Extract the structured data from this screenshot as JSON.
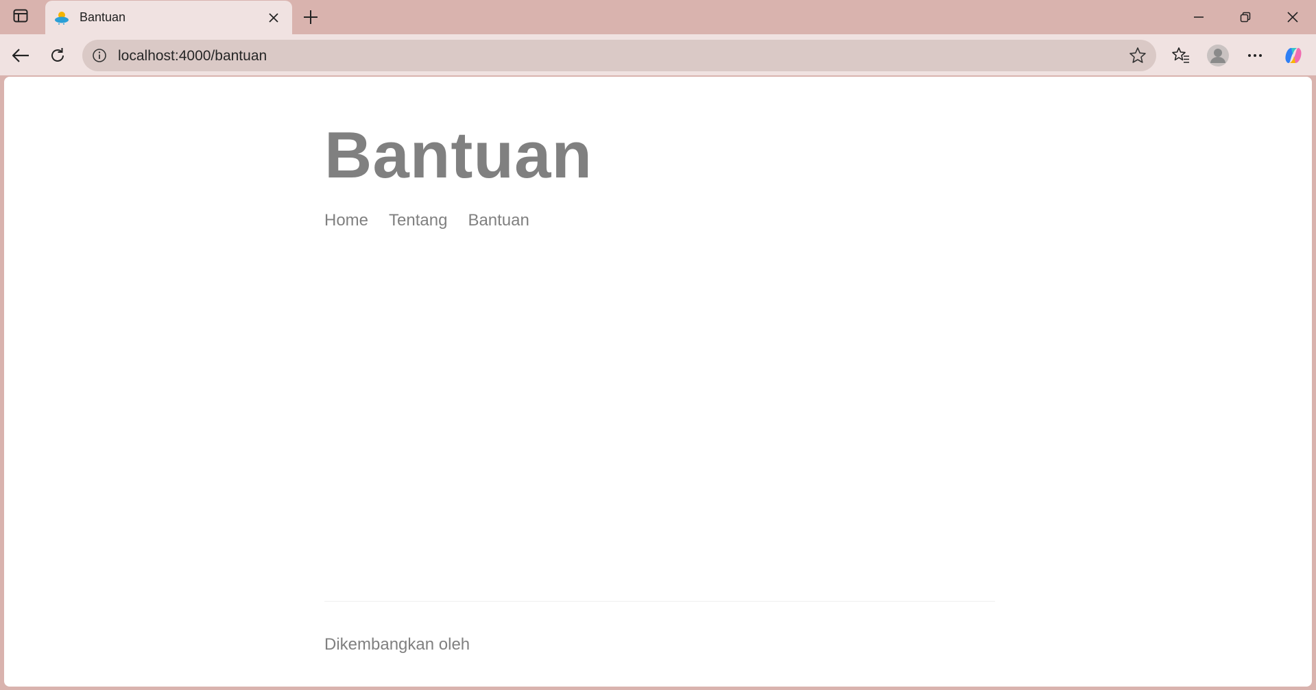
{
  "browser": {
    "tab": {
      "title": "Bantuan",
      "favicon": "weather-cloud-sun-icon"
    },
    "address": {
      "url": "localhost:4000/bantuan"
    },
    "icons": {
      "tab_actions": "tab-actions-icon",
      "close_tab": "close-icon",
      "new_tab": "plus-icon",
      "minimize": "minimize-icon",
      "restore": "restore-icon",
      "close_window": "close-icon",
      "back": "back-arrow-icon",
      "refresh": "refresh-icon",
      "site_info": "info-icon",
      "favorite": "star-icon",
      "favorites": "favorites-icon",
      "profile": "profile-icon",
      "more": "more-icon",
      "copilot": "copilot-icon"
    },
    "colors": {
      "frame": "#d9b3ae",
      "toolbar": "#f0e2e1",
      "address_bar": "#dac9c6"
    }
  },
  "page": {
    "title": "Bantuan",
    "nav": [
      {
        "label": "Home"
      },
      {
        "label": "Tentang"
      },
      {
        "label": "Bantuan"
      }
    ],
    "footer": {
      "text": "Dikembangkan oleh"
    },
    "colors": {
      "text": "#808080",
      "background": "#ffffff",
      "rule": "#eeeeee"
    }
  }
}
